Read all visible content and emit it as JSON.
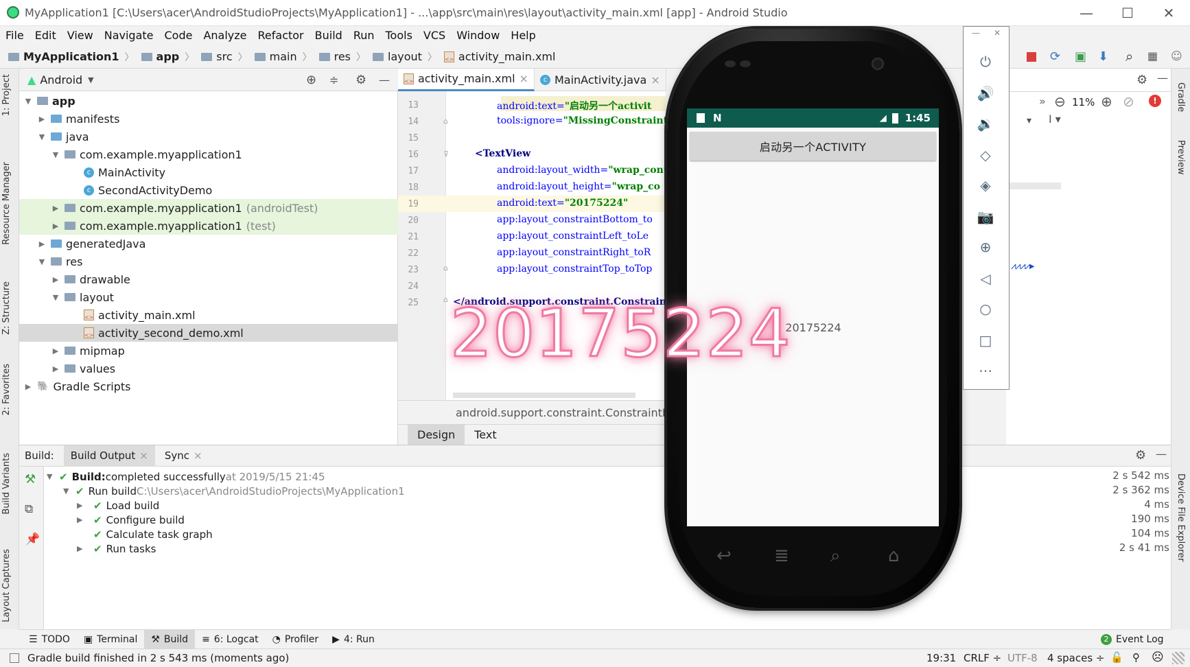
{
  "window": {
    "title": "MyApplication1 [C:\\Users\\acer\\AndroidStudioProjects\\MyApplication1] - ...\\app\\src\\main\\res\\layout\\activity_main.xml [app] - Android Studio",
    "minimize": "—",
    "maximize": "☐",
    "close": "✕"
  },
  "menu": [
    "File",
    "Edit",
    "View",
    "Navigate",
    "Code",
    "Analyze",
    "Refactor",
    "Build",
    "Run",
    "Tools",
    "VCS",
    "Window",
    "Help"
  ],
  "breadcrumbs": [
    "MyApplication1",
    "app",
    "src",
    "main",
    "res",
    "layout",
    "activity_main.xml"
  ],
  "project": {
    "view": "Android",
    "tree": [
      {
        "label": "app",
        "level": 0,
        "arrow": "▼",
        "kind": "folder"
      },
      {
        "label": "manifests",
        "level": 1,
        "arrow": "▶",
        "kind": "folder"
      },
      {
        "label": "java",
        "level": 1,
        "arrow": "▼",
        "kind": "folder"
      },
      {
        "label": "com.example.myapplication1",
        "level": 2,
        "arrow": "▼",
        "kind": "package"
      },
      {
        "label": "MainActivity",
        "level": 3,
        "arrow": "",
        "kind": "class"
      },
      {
        "label": "SecondActivityDemo",
        "level": 3,
        "arrow": "",
        "kind": "class"
      },
      {
        "label": "com.example.myapplication1",
        "suffix": "(androidTest)",
        "level": 2,
        "arrow": "▶",
        "kind": "package"
      },
      {
        "label": "com.example.myapplication1",
        "suffix": "(test)",
        "level": 2,
        "arrow": "▶",
        "kind": "package"
      },
      {
        "label": "generatedJava",
        "level": 1,
        "arrow": "▶",
        "kind": "folder"
      },
      {
        "label": "res",
        "level": 1,
        "arrow": "▼",
        "kind": "folder"
      },
      {
        "label": "drawable",
        "level": 2,
        "arrow": "▶",
        "kind": "folder"
      },
      {
        "label": "layout",
        "level": 2,
        "arrow": "▼",
        "kind": "folder"
      },
      {
        "label": "activity_main.xml",
        "level": 3,
        "arrow": "",
        "kind": "xml"
      },
      {
        "label": "activity_second_demo.xml",
        "level": 3,
        "arrow": "",
        "kind": "xml"
      },
      {
        "label": "mipmap",
        "level": 2,
        "arrow": "▶",
        "kind": "folder"
      },
      {
        "label": "values",
        "level": 2,
        "arrow": "▶",
        "kind": "folder"
      },
      {
        "label": "Gradle Scripts",
        "level": 0,
        "arrow": "▶",
        "kind": "gradle"
      }
    ]
  },
  "editor": {
    "tabs": [
      {
        "label": "activity_main.xml",
        "close": "×"
      },
      {
        "label": "MainActivity.java",
        "close": "×"
      }
    ],
    "lines": [
      {
        "num": "13",
        "attr": "android:text=",
        "val": "\"启动另一个activit"
      },
      {
        "num": "14",
        "attr": "tools:ignore=",
        "val": "\"MissingConstraint"
      },
      {
        "num": "15",
        "attr": "",
        "val": ""
      },
      {
        "num": "16",
        "attr": "<TextView",
        "val": ""
      },
      {
        "num": "17",
        "attr": "android:layout_width=",
        "val": "\"wrap_cont"
      },
      {
        "num": "18",
        "attr": "android:layout_height=",
        "val": "\"wrap_co"
      },
      {
        "num": "19",
        "attr": "android:text=",
        "val": "\"20175224\""
      },
      {
        "num": "20",
        "attr": "app:layout_constraintBottom_to",
        "val": ""
      },
      {
        "num": "21",
        "attr": "app:layout_constraintLeft_toLe",
        "val": ""
      },
      {
        "num": "22",
        "attr": "app:layout_constraintRight_toR",
        "val": ""
      },
      {
        "num": "23",
        "attr": "app:layout_constraintTop_toTop",
        "val": ""
      },
      {
        "num": "24",
        "attr": "",
        "val": ""
      },
      {
        "num": "25",
        "attr": "</android.support.constraint.Constraint",
        "val": ""
      }
    ],
    "footer": "android.support.constraint.ConstraintLayo",
    "mode_tabs": [
      "Design",
      "Text"
    ],
    "zoom": "11%"
  },
  "emulator": {
    "time": "1:45",
    "button_label": "启动另一个ACTIVITY",
    "text_value": "20175224",
    "tool_close": "✕",
    "tool_min": "—"
  },
  "overlay_text": "20175224",
  "build": {
    "label": "Build:",
    "tabs": [
      {
        "label": "Build Output",
        "close": "×"
      },
      {
        "label": "Sync",
        "close": "×"
      }
    ],
    "rows": [
      {
        "indent": 0,
        "arrow": "▼",
        "bold": "Build:",
        "text": " completed successfully",
        "dim": " at 2019/5/15 21:45",
        "time": "2 s 542 ms"
      },
      {
        "indent": 1,
        "arrow": "▼",
        "bold": "",
        "text": "Run build",
        "dim": " C:\\Users\\acer\\AndroidStudioProjects\\MyApplication1",
        "time": "2 s 362 ms"
      },
      {
        "indent": 2,
        "arrow": "▶",
        "bold": "",
        "text": "Load build",
        "dim": "",
        "time": "4 ms"
      },
      {
        "indent": 2,
        "arrow": "▶",
        "bold": "",
        "text": "Configure build",
        "dim": "",
        "time": "190 ms"
      },
      {
        "indent": 2,
        "arrow": "",
        "bold": "",
        "text": "Calculate task graph",
        "dim": "",
        "time": "104 ms"
      },
      {
        "indent": 2,
        "arrow": "▶",
        "bold": "",
        "text": "Run tasks",
        "dim": "",
        "time": "2 s 41 ms"
      }
    ]
  },
  "bottom_tools": [
    "TODO",
    "Terminal",
    "Build",
    "6: Logcat",
    "Profiler",
    "4: Run"
  ],
  "event_log": "Event Log",
  "event_log_badge": "2",
  "status": {
    "message": "Gradle build finished in 2 s 543 ms (moments ago)",
    "position": "19:31",
    "line_sep": "CRLF ÷",
    "encoding": "UTF-8",
    "indent": "4 spaces ÷"
  },
  "left_tabs": [
    "1: Project",
    "Resource Manager",
    "Z: Structure",
    "2: Favorites",
    "Build Variants",
    "Layout Captures"
  ],
  "right_tabs": [
    "Gradle",
    "Preview",
    "Device File Explorer"
  ],
  "colors": {
    "accent": "#4a88c7",
    "success": "#3da13d",
    "statusbar_android": "#0e5c4e",
    "overlay_stroke": "#f07aa0"
  }
}
